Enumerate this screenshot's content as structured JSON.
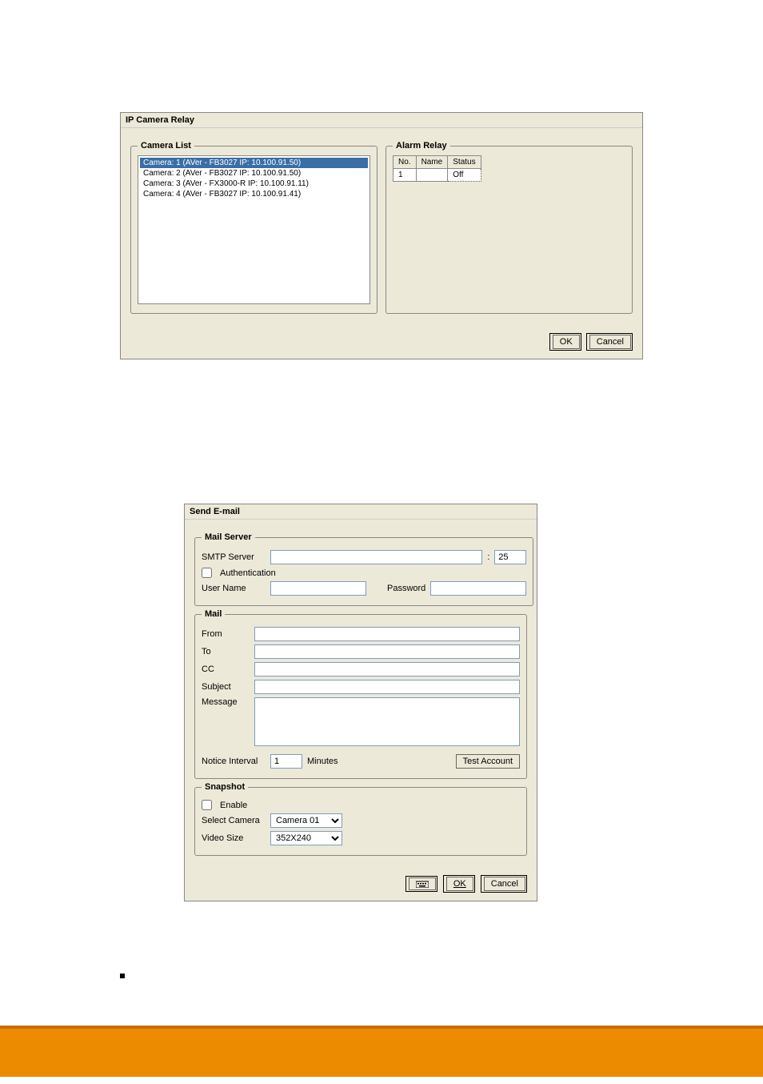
{
  "ip_relay": {
    "title": "IP Camera Relay",
    "camera_list": {
      "legend": "Camera List",
      "items": [
        "Camera: 1 (AVer - FB3027 IP: 10.100.91.50)",
        "Camera: 2 (AVer - FB3027 IP: 10.100.91.50)",
        "Camera: 3 (AVer - FX3000-R IP: 10.100.91.11)",
        "Camera: 4 (AVer - FB3027 IP: 10.100.91.41)"
      ]
    },
    "alarm_relay": {
      "legend": "Alarm Relay",
      "headers": {
        "no": "No.",
        "name": "Name",
        "status": "Status"
      },
      "rows": [
        {
          "no": "1",
          "name": "",
          "status": "Off"
        }
      ]
    },
    "buttons": {
      "ok": "OK",
      "cancel": "Cancel"
    }
  },
  "send_email": {
    "title": "Send E-mail",
    "mail_server": {
      "legend": "Mail Server",
      "smtp_label": "SMTP Server",
      "smtp_value": "",
      "port_value": "25",
      "auth_label": "Authentication",
      "auth_checked": false,
      "user_label": "User Name",
      "user_value": "",
      "pass_label": "Password",
      "pass_value": ""
    },
    "mail": {
      "legend": "Mail",
      "from_label": "From",
      "from_value": "",
      "to_label": "To",
      "to_value": "",
      "cc_label": "CC",
      "cc_value": "",
      "subject_label": "Subject",
      "subject_value": "",
      "message_label": "Message",
      "message_value": "",
      "notice_label": "Notice Interval",
      "notice_value": "1",
      "notice_unit": "Minutes",
      "test_label": "Test Account"
    },
    "snapshot": {
      "legend": "Snapshot",
      "enable_label": "Enable",
      "enable_checked": false,
      "camera_label": "Select Camera",
      "camera_value": "Camera 01",
      "size_label": "Video Size",
      "size_value": "352X240"
    },
    "buttons": {
      "ok": "OK",
      "cancel": "Cancel"
    }
  }
}
